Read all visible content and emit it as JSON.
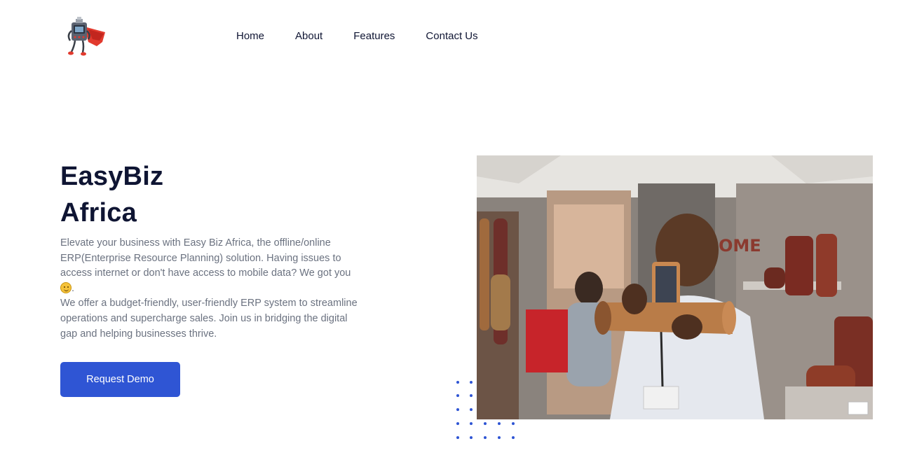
{
  "nav": {
    "items": [
      {
        "label": "Home"
      },
      {
        "label": "About"
      },
      {
        "label": "Features"
      },
      {
        "label": "Contact Us"
      }
    ]
  },
  "hero": {
    "title_line1": "EasyBiz",
    "title_line2": "Africa",
    "paragraph1": "Elevate your business with Easy Biz Africa, the offline/online ERP(Enterprise Resource Planning) solution. Having issues to access internet or don't have access to mobile data? We got you",
    "paragraph1_end": ".",
    "paragraph2": "We offer a budget-friendly, user-friendly ERP system to streamline operations and supercharge sales. Join us in bridging the digital gap and helping businesses thrive.",
    "cta_label": "Request Demo"
  },
  "colors": {
    "accent": "#2f55d4",
    "heading": "#0f1533",
    "body_text": "#6b7280"
  },
  "icons": {
    "logo": "superhero-robot-logo",
    "emoji": "smiling-face-emoji"
  }
}
